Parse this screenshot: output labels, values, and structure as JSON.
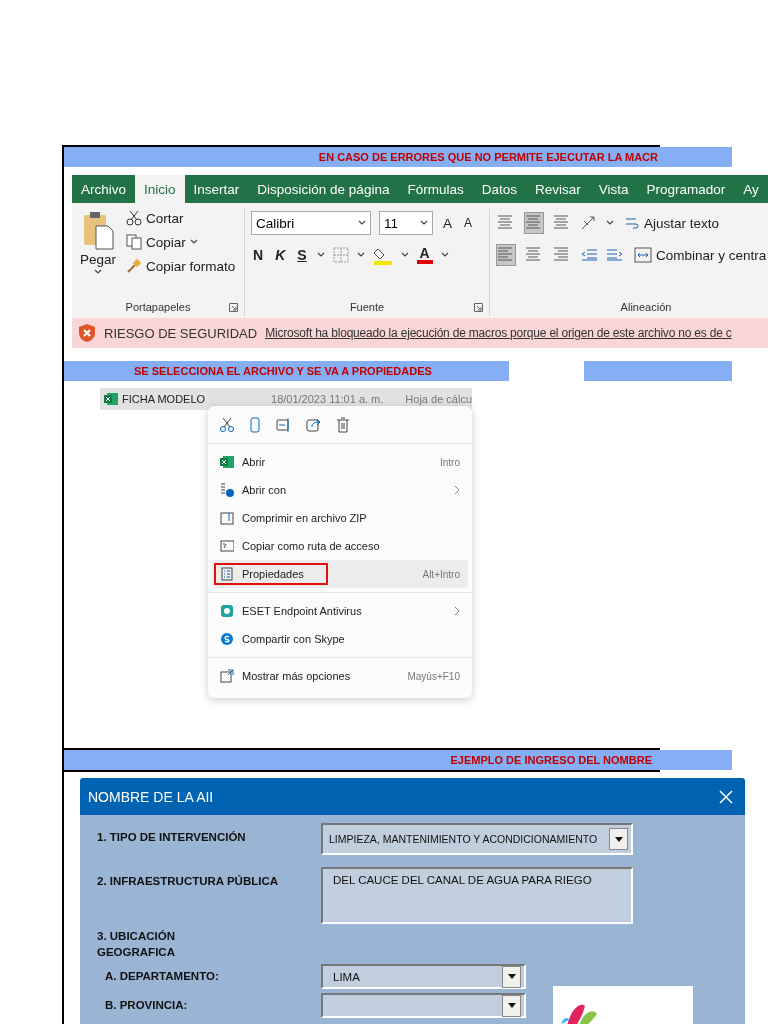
{
  "banner_1": {
    "text": "EN CASO DE ERRORES QUE NO PERMITE EJECUTAR LA MACR"
  },
  "excel": {
    "tabs": [
      {
        "label": "Archivo",
        "selected": false
      },
      {
        "label": "Inicio",
        "selected": true
      },
      {
        "label": "Insertar",
        "selected": false
      },
      {
        "label": "Disposición de página",
        "selected": false
      },
      {
        "label": "Fórmulas",
        "selected": false
      },
      {
        "label": "Datos",
        "selected": false
      },
      {
        "label": "Revisar",
        "selected": false
      },
      {
        "label": "Vista",
        "selected": false
      },
      {
        "label": "Programador",
        "selected": false
      },
      {
        "label": "Ay",
        "selected": false
      }
    ],
    "clipboard": {
      "paste": "Pegar",
      "cut": "Cortar",
      "copy": "Copiar",
      "format_painter": "Copiar formato",
      "group": "Portapapeles"
    },
    "font": {
      "name": "Calibri",
      "size": "11",
      "grow": "A",
      "shrink": "A",
      "bold": "N",
      "italic": "K",
      "underline": "S",
      "font_color": "A",
      "group": "Fuente"
    },
    "alignment": {
      "wrap": "Ajustar texto",
      "merge": "Combinar y centra",
      "group": "Alineación"
    },
    "security_bar": {
      "title": "RIESGO DE SEGURIDAD",
      "message": "Microsoft ha bloqueado la ejecución de macros porque el origen de este archivo no es de c"
    }
  },
  "banner_2": {
    "text": "SE SELECCIONA EL ARCHIVO Y SE VA A PROPIEDADES"
  },
  "explorer": {
    "file": {
      "name": "FICHA MODELO",
      "date": "18/01/2023 11:01 a. m.",
      "type": "Hoja de cálcu"
    },
    "sections": [
      {
        "items": [
          {
            "label": "Abrir",
            "shortcut": "Intro",
            "submenu": false,
            "selected": false
          },
          {
            "label": "Abrir con",
            "submenu": true,
            "selected": false
          },
          {
            "label": "Comprimir en archivo ZIP",
            "submenu": false,
            "selected": false
          },
          {
            "label": "Copiar como ruta de acceso",
            "submenu": false,
            "selected": false
          },
          {
            "label": "Propiedades",
            "shortcut": "Alt+Intro",
            "submenu": false,
            "selected": true
          }
        ]
      },
      {
        "items": [
          {
            "label": "ESET Endpoint Antivirus",
            "submenu": true,
            "selected": false
          },
          {
            "label": "Compartir con Skype",
            "submenu": false,
            "selected": false
          }
        ]
      },
      {
        "items": [
          {
            "label": "Mostrar más opciones",
            "shortcut": "Mayús+F10",
            "submenu": false,
            "selected": false
          }
        ]
      }
    ]
  },
  "banner_3": {
    "text": "EJEMPLO DE INGRESO DEL NOMBRE"
  },
  "dialog": {
    "title": "NOMBRE DE LA AII",
    "fields": [
      {
        "kind": "dropdown",
        "label": "1. TIPO DE INTERVENCIÓN",
        "value": "LIMPIEZA, MANTENIMIENTO Y ACONDICIONAMIENTO"
      },
      {
        "kind": "textarea",
        "label": "2. INFRAESTRUCTURA PÚBLICA",
        "value": "DEL CAUCE DEL CANAL DE AGUA PARA RIEGO"
      },
      {
        "kind": "heading",
        "label": "3. UBICACIÓN GEOGRAFICA"
      },
      {
        "kind": "dropdown",
        "label": "A. DEPARTAMENTO:",
        "value": "LIMA"
      },
      {
        "kind": "dropdown",
        "label": "B. PROVINCIA:"
      }
    ]
  }
}
